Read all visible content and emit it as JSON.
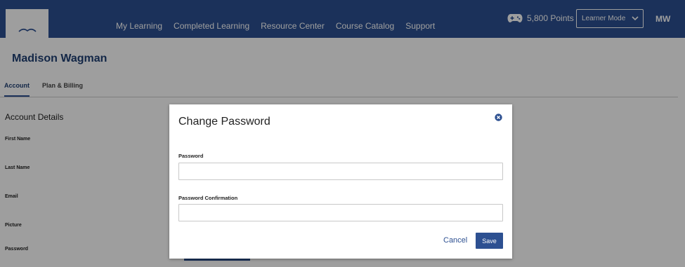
{
  "nav": {
    "items": [
      {
        "label": "My Learning"
      },
      {
        "label": "Completed Learning"
      },
      {
        "label": "Resource Center"
      },
      {
        "label": "Course Catalog"
      },
      {
        "label": "Support"
      }
    ],
    "points": "5,800 Points",
    "mode": "Learner Mode",
    "user_initials": "MW"
  },
  "profile": {
    "name": "Madison Wagman",
    "tabs": [
      {
        "label": "Account"
      },
      {
        "label": "Plan & Billing"
      }
    ],
    "section_title": "Account Details",
    "fields": [
      {
        "label": "First Name"
      },
      {
        "label": "Last Name"
      },
      {
        "label": "Email"
      },
      {
        "label": "Picture"
      },
      {
        "label": "Password"
      }
    ]
  },
  "modal": {
    "title": "Change Password",
    "password_label": "Password",
    "password_value": "",
    "confirm_label": "Password Confirmation",
    "confirm_value": "",
    "cancel_label": "Cancel",
    "save_label": "Save"
  },
  "colors": {
    "brand": "#2d5091",
    "overlay": "rgba(0,0,0,0.38)"
  }
}
